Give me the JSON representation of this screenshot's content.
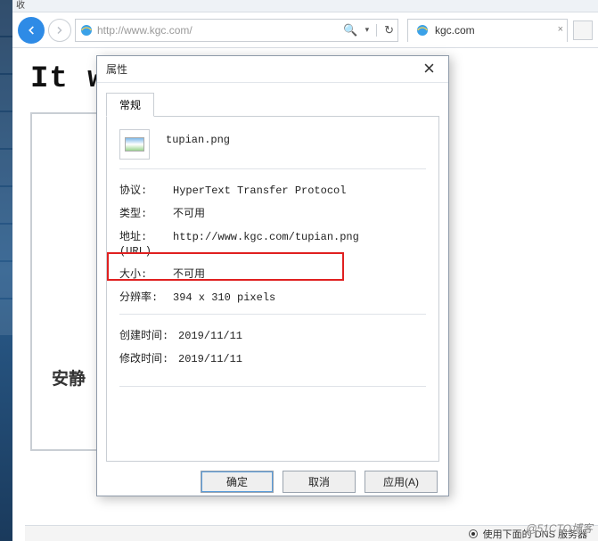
{
  "favBar": {
    "label": "收"
  },
  "nav": {
    "url": "http://www.kgc.com/",
    "searchIcon": "search-icon",
    "refreshIcon": "refresh-icon"
  },
  "tab": {
    "title": "kgc.com"
  },
  "page": {
    "heading_partial": "It wo",
    "subheading": "安静"
  },
  "dialog": {
    "title": "属性",
    "tab_general": "常规",
    "file_name": "tupian.png",
    "rows": {
      "protocol_label": "协议:",
      "protocol_value": "HyperText Transfer Protocol",
      "type_label": "类型:",
      "type_value": "不可用",
      "url_label_line1": "地址:",
      "url_label_line2": "(URL)",
      "url_value": "http://www.kgc.com/tupian.png",
      "size_label": "大小:",
      "size_value": "不可用",
      "dim_label": "分辨率:",
      "dim_value": "394  x  310  pixels",
      "created_label": "创建时间:",
      "created_value": "2019/11/11",
      "modified_label": "修改时间:",
      "modified_value": "2019/11/11"
    },
    "buttons": {
      "ok": "确定",
      "cancel": "取消",
      "apply": "应用(A)"
    }
  },
  "status": {
    "radio_label": "使用下面的 DNS 服务器"
  },
  "watermark": "@51CTO博客"
}
